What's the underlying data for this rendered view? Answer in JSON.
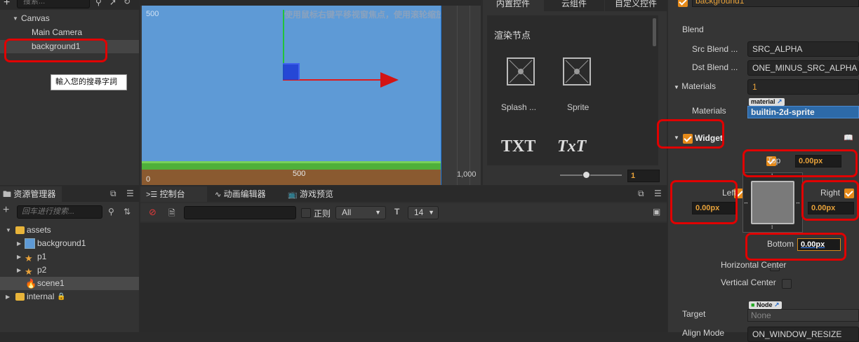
{
  "hierarchy": {
    "search_placeholder": "搜索...",
    "items": [
      {
        "label": "Canvas"
      },
      {
        "label": "Main Camera"
      },
      {
        "label": "background1"
      }
    ],
    "tooltip": "輸入您的搜尋字詞"
  },
  "scene": {
    "hint": "使用鼠标右键平移视窗焦点，使用滚轮缩放视图",
    "y_top_label": "500",
    "x_zero_label": "0",
    "x_mid_label": "500",
    "x_right_label": "1,000"
  },
  "widgets_panel": {
    "tabs": [
      "内置控件",
      "云组件",
      "自定义控件"
    ],
    "section_title": "渲染节点",
    "items": [
      {
        "label": "Splash ...",
        "icon": "splash-icon"
      },
      {
        "label": "Sprite",
        "icon": "sprite-icon"
      }
    ],
    "text_items": [
      "TXT",
      "TxT"
    ],
    "zoom_value": "1"
  },
  "assets": {
    "tab_label": "资源管理器",
    "search_placeholder": "回车进行搜索...",
    "items": [
      {
        "label": "assets",
        "icon": "folder-icon"
      },
      {
        "label": "background1",
        "icon": "image-icon"
      },
      {
        "label": "p1",
        "icon": "prefab-icon"
      },
      {
        "label": "p2",
        "icon": "prefab-icon"
      },
      {
        "label": "scene1",
        "icon": "scene-icon"
      },
      {
        "label": "internal",
        "icon": "folder-icon"
      }
    ]
  },
  "console": {
    "tabs": [
      {
        "label": "控制台",
        "icon": "console-icon"
      },
      {
        "label": "动画编辑器",
        "icon": "animation-icon"
      },
      {
        "label": "游戏预览",
        "icon": "game-preview-icon"
      }
    ],
    "regex_label": "正则",
    "level_select": "All",
    "font_size_select": "14"
  },
  "inspector": {
    "node_name": "background1",
    "blend_label": "Blend",
    "src_blend_label": "Src Blend ...",
    "src_blend_value": "SRC_ALPHA",
    "dst_blend_label": "Dst Blend ...",
    "dst_blend_value": "ONE_MINUS_SRC_ALPHA",
    "materials_header": "Materials",
    "materials_count": "1",
    "material_tag": "material",
    "materials_label": "Materials",
    "material_value": "builtin-2d-sprite",
    "widget_label": "Widget",
    "top_label": "Top",
    "top_value": "0.00px",
    "left_label": "Left",
    "left_value": "0.00px",
    "right_label": "Right",
    "right_value": "0.00px",
    "bottom_label": "Bottom",
    "bottom_value": "0.00px",
    "hcenter_label": "Horizontal Center",
    "vcenter_label": "Vertical Center",
    "target_label": "Target",
    "node_tag": "Node",
    "target_value": "None",
    "align_mode_label": "Align Mode",
    "align_mode_value": "ON_WINDOW_RESIZE"
  },
  "colors": {
    "accent": "#e58a1a",
    "scene_sky": "#5e9ad6",
    "highlight_red": "#e00000"
  }
}
